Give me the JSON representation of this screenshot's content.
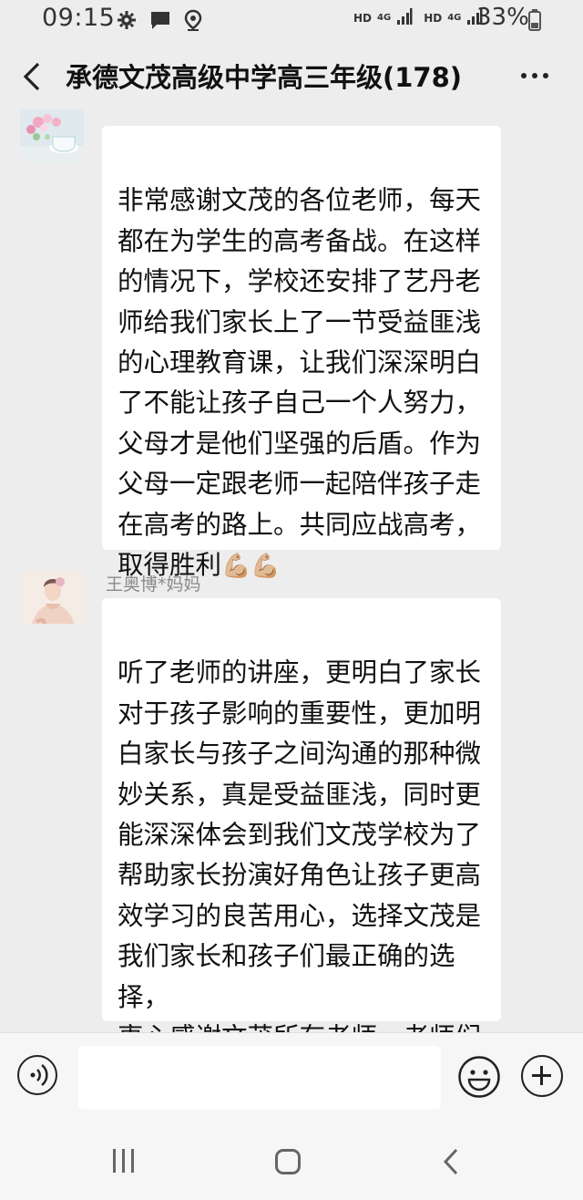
{
  "status_bar": {
    "time": "09:15",
    "icons": [
      "gear-icon",
      "chat-notification-icon",
      "location-icon"
    ],
    "network": [
      {
        "hd": "HD",
        "type": "4G"
      },
      {
        "hd": "HD",
        "type": "4G"
      }
    ],
    "battery_percent": "33%"
  },
  "header": {
    "title": "承德文茂高级中学高三年级(178)",
    "back_icon": "chevron-left-icon",
    "more_icon": "more-dots-icon"
  },
  "messages": [
    {
      "sender": "",
      "avatar": "flowers-teacup-avatar",
      "text": "非常感谢文茂的各位老师，每天\n都在为学生的高考备战。在这样\n的情况下，学校还安排了艺丹老\n师给我们家长上了一节受益匪浅\n的心理教育课，让我们深深明白\n了不能让孩子自己一个人努力，\n父母才是他们坚强的后盾。作为\n父母一定跟老师一起陪伴孩子走\n在高考的路上。共同应战高考，\n取得胜利",
      "emoji": "💪🏼💪🏼"
    },
    {
      "sender": "王奥博*妈妈",
      "avatar": "woman-portrait-avatar",
      "text": "听了老师的讲座，更明白了家长\n对于孩子影响的重要性，更加明\n白家长与孩子之间沟通的那种微\n妙关系，真是受益匪浅，同时更\n能深深体会到我们文茂学校为了\n帮助家长扮演好角色让孩子更高\n效学习的良苦用心，选择文茂是\n我们家长和孩子们最正确的选择，\n衷心感谢文茂所有老师，老师们\n辛苦了。"
    }
  ],
  "input_bar": {
    "voice_icon": "voice-input-icon",
    "text_value": "",
    "emoji_icon": "emoji-icon",
    "plus_icon": "plus-icon"
  },
  "nav_bar": {
    "icons": [
      "recent-apps-icon",
      "home-icon",
      "back-icon"
    ]
  },
  "colors": {
    "background": "#ededed",
    "bubble": "#ffffff",
    "sender_name": "#8a8a8a"
  }
}
